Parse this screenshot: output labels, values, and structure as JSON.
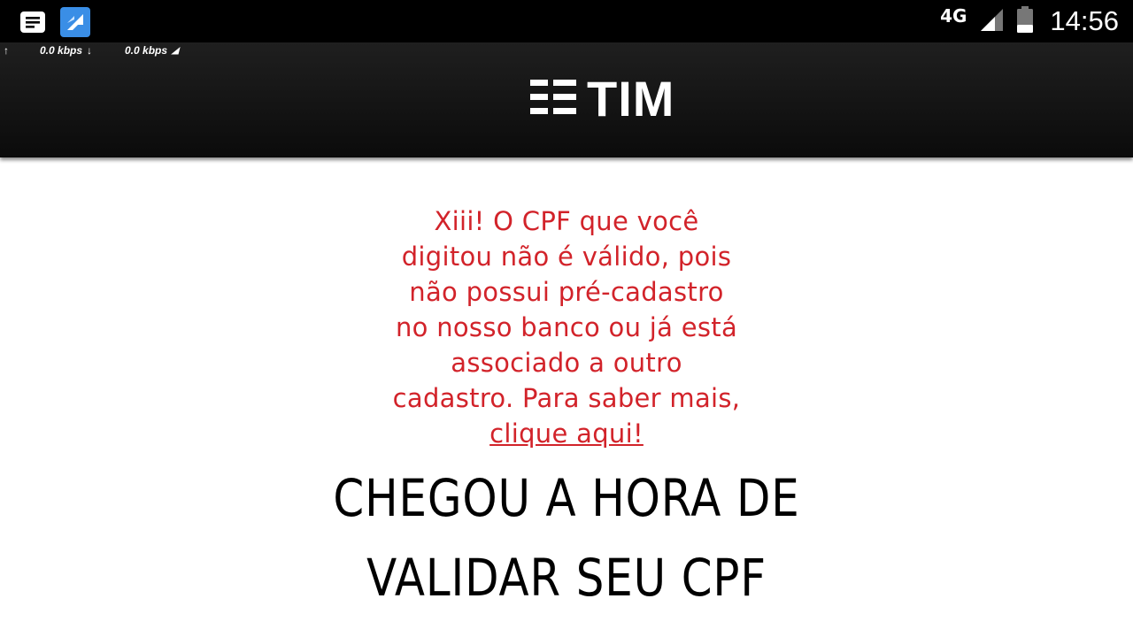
{
  "status_bar": {
    "network_type": "4G",
    "time": "14:56",
    "icons": [
      "notification-icon",
      "app-icon",
      "signal-icon",
      "battery-icon"
    ]
  },
  "speed_bar": {
    "upload": "0.0 kbps",
    "download": "0.0 kbps"
  },
  "header": {
    "logo_text": "TIM"
  },
  "content": {
    "error_lines": [
      "Xiii! O CPF que você",
      "digitou não é válido, pois",
      "não possui pré-cadastro",
      "no nosso banco ou já está",
      "associado a outro",
      "cadastro. Para saber mais,"
    ],
    "error_link": "clique aqui!",
    "headline_lines": [
      "CHEGOU A HORA DE",
      "VALIDAR SEU CPF"
    ]
  },
  "colors": {
    "error": "#d2232a",
    "header": "#111111"
  }
}
